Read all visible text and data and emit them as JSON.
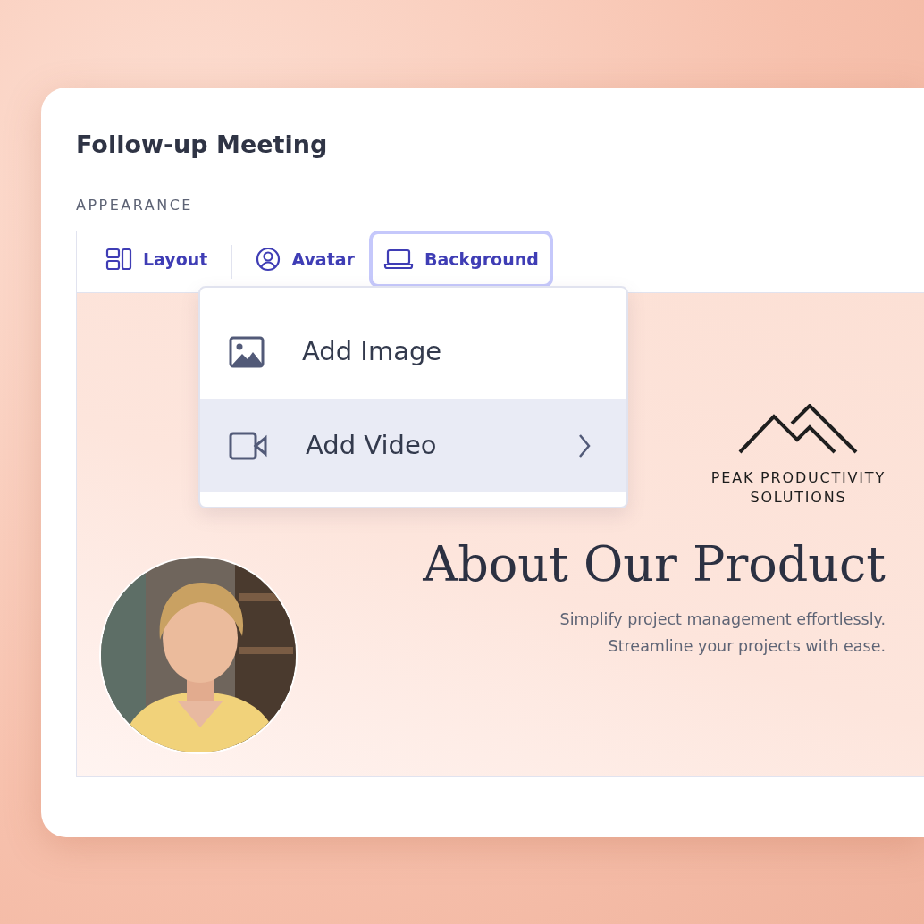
{
  "title": "Follow-up Meeting",
  "section_label": "APPEARANCE",
  "tabs": [
    {
      "label": "Layout",
      "selected": false
    },
    {
      "label": "Avatar",
      "selected": false
    },
    {
      "label": "Background",
      "selected": true
    }
  ],
  "menu": {
    "expanded": true,
    "items": [
      {
        "label": "Add Image",
        "selected": false,
        "submenu": false
      },
      {
        "label": "Add Video",
        "selected": true,
        "submenu": true
      }
    ]
  },
  "preview": {
    "avatar": {
      "kind": "picture"
    },
    "logo_lines": [
      "PEAK PRODUCTIVITY",
      "SOLUTIONS"
    ],
    "heading": "About Our Product",
    "subtitle_lines": [
      "Simplify project management effortlessly.",
      "Streamline your projects with ease."
    ]
  }
}
